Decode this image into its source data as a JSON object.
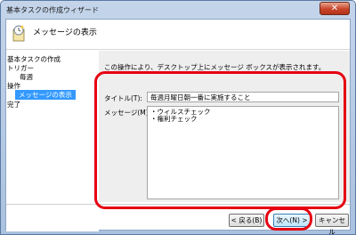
{
  "window": {
    "title": "基本タスクの作成ウィザード",
    "close_glyph": "✕"
  },
  "header": {
    "title": "メッセージの表示",
    "icon": "task-clock-icon"
  },
  "sidebar": {
    "items": [
      {
        "label": "基本タスクの作成",
        "selected": false
      },
      {
        "label": "トリガー",
        "selected": false
      },
      {
        "label": "毎週",
        "selected": false
      },
      {
        "label": "操作",
        "selected": false
      },
      {
        "label": "メッセージの表示",
        "selected": true
      },
      {
        "label": "完了",
        "selected": false
      }
    ]
  },
  "main": {
    "description": "この操作により、デスクトップ上にメッセージ ボックスが表示されます。",
    "title_label": "タイトル(T):",
    "title_value": "毎週月曜日朝一番に実施すること",
    "message_label": "メッセージ(M):",
    "message_lines": [
      "・ウィルスチェック",
      "・権利チェック"
    ]
  },
  "buttons": {
    "back": "< 戻る(B)",
    "next": "次へ(N) >",
    "cancel": "キャンセル"
  },
  "colors": {
    "highlight": "#e60012",
    "selection": "#3399ff"
  }
}
